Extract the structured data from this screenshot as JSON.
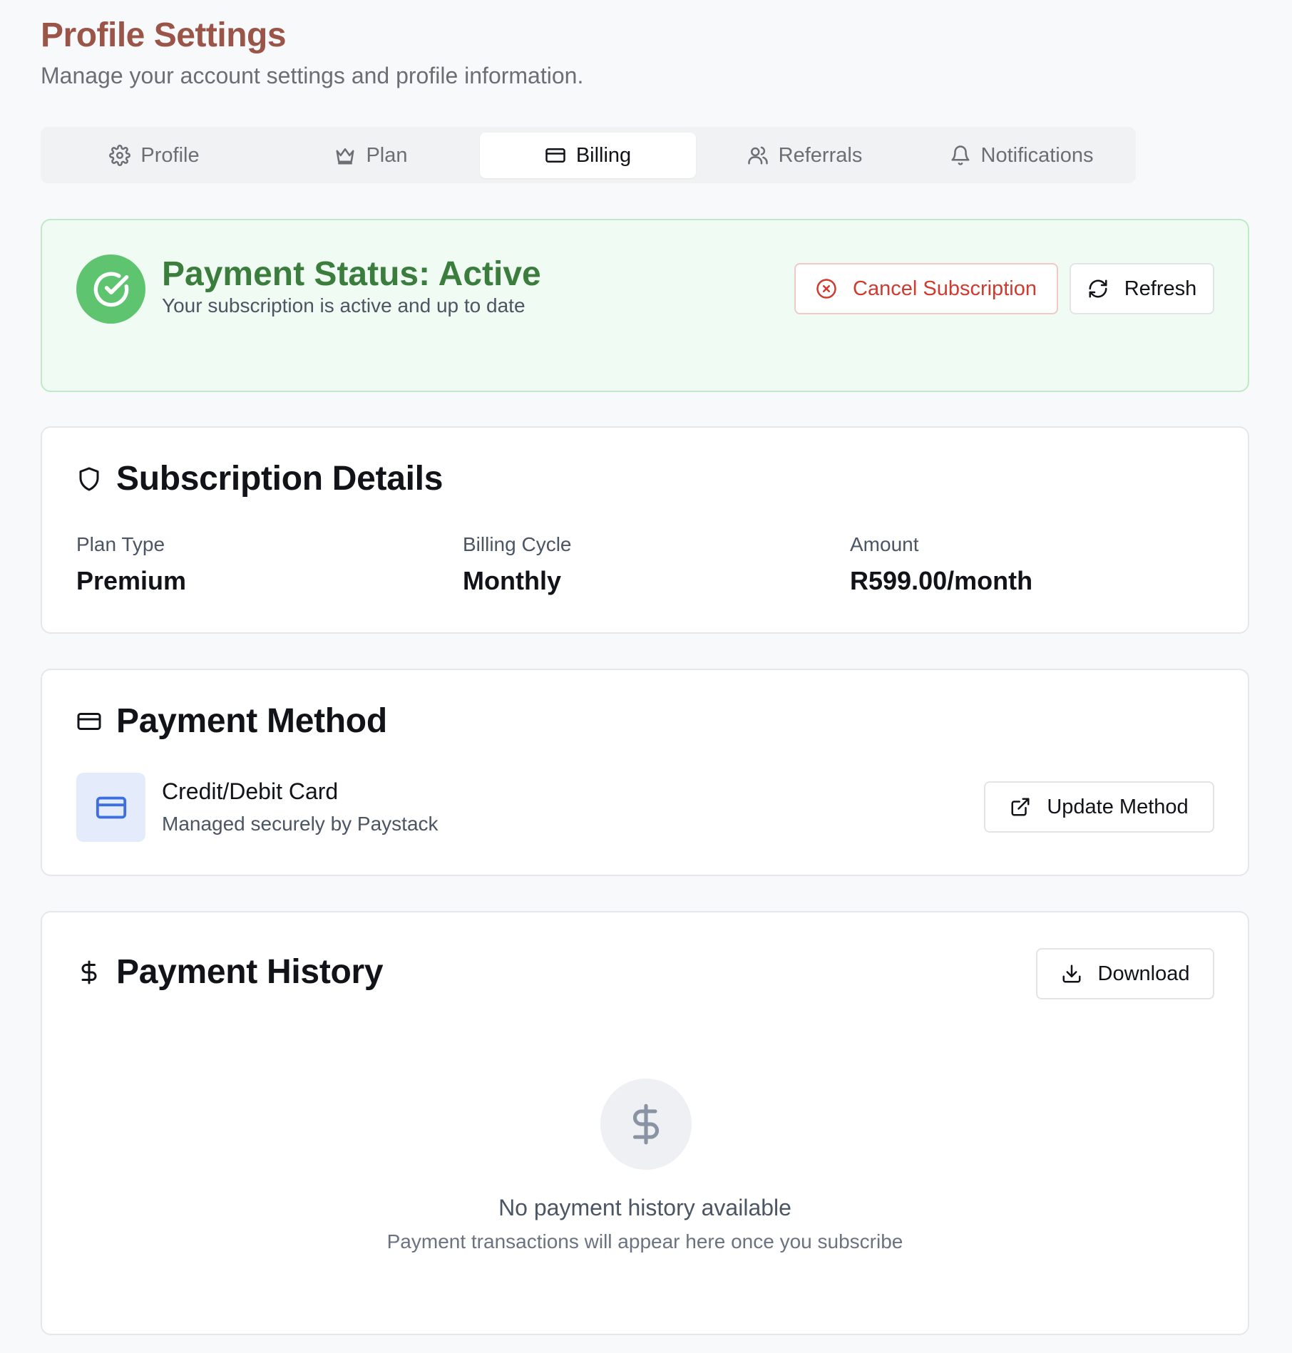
{
  "header": {
    "title": "Profile Settings",
    "subtitle": "Manage your account settings and profile information."
  },
  "tabs": [
    {
      "label": "Profile",
      "icon": "gear-icon",
      "active": false
    },
    {
      "label": "Plan",
      "icon": "crown-icon",
      "active": false
    },
    {
      "label": "Billing",
      "icon": "credit-card-icon",
      "active": true
    },
    {
      "label": "Referrals",
      "icon": "users-icon",
      "active": false
    },
    {
      "label": "Notifications",
      "icon": "bell-icon",
      "active": false
    }
  ],
  "status": {
    "title": "Payment Status: Active",
    "subtitle": "Your subscription is active and up to date",
    "cancel_label": "Cancel Subscription",
    "refresh_label": "Refresh"
  },
  "subscription": {
    "title": "Subscription Details",
    "plan_type_label": "Plan Type",
    "plan_type_value": "Premium",
    "billing_cycle_label": "Billing Cycle",
    "billing_cycle_value": "Monthly",
    "amount_label": "Amount",
    "amount_value": "R599.00/month"
  },
  "payment_method": {
    "title": "Payment Method",
    "name": "Credit/Debit Card",
    "subtitle": "Managed securely by Paystack",
    "update_label": "Update Method"
  },
  "payment_history": {
    "title": "Payment History",
    "download_label": "Download",
    "empty_title": "No payment history available",
    "empty_subtitle": "Payment transactions will appear here once you subscribe"
  },
  "colors": {
    "brand_title": "#9a5548",
    "status_green": "#3a7d3d",
    "status_badge": "#5ec46f",
    "danger": "#d03a2f",
    "card_icon": "#3e6fe0"
  }
}
